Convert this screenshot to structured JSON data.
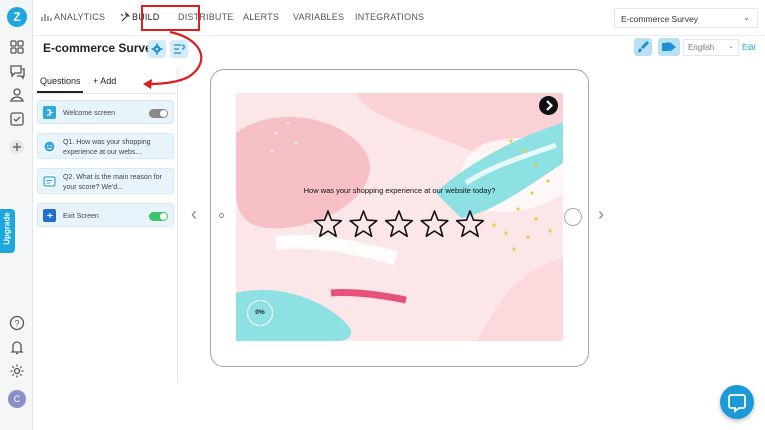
{
  "brand": {
    "logo_letter": "Z",
    "accent": "#1ba8e0",
    "highlight": "#e01b22"
  },
  "rail": {
    "icons": [
      "grid-icon",
      "chat-icon",
      "user-icon",
      "checklist-icon",
      "plus-icon"
    ],
    "bottom_icons": [
      "help-icon",
      "bell-icon",
      "gear-icon"
    ],
    "upgrade_label": "Upgrade",
    "avatar_letter": "C"
  },
  "nav": {
    "items": [
      "ANALYTICS",
      "BUILD",
      "DISTRIBUTE",
      "ALERTS",
      "VARIABLES",
      "INTEGRATIONS"
    ],
    "active": "BUILD"
  },
  "survey_select": {
    "value": "E-commerce Survey"
  },
  "title": "E-commerce Survey",
  "language": {
    "value": "English",
    "edit_label": "Edit"
  },
  "panel": {
    "tabs": [
      "Questions",
      "+ Add"
    ],
    "items": [
      {
        "label": "Welcome screen",
        "toggle": "off",
        "icon": "welcome-icon"
      },
      {
        "label": "Q1. How was your shopping experience at our webs...",
        "icon": "smiley-icon"
      },
      {
        "label": "Q2. What is the main reason for your score? We'd...",
        "icon": "text-box-icon"
      },
      {
        "label": "Exit Screen",
        "toggle": "on",
        "icon": "exit-icon"
      }
    ]
  },
  "preview": {
    "question": "How was your shopping experience at our website today?",
    "stars": 5,
    "progress": "0%"
  }
}
